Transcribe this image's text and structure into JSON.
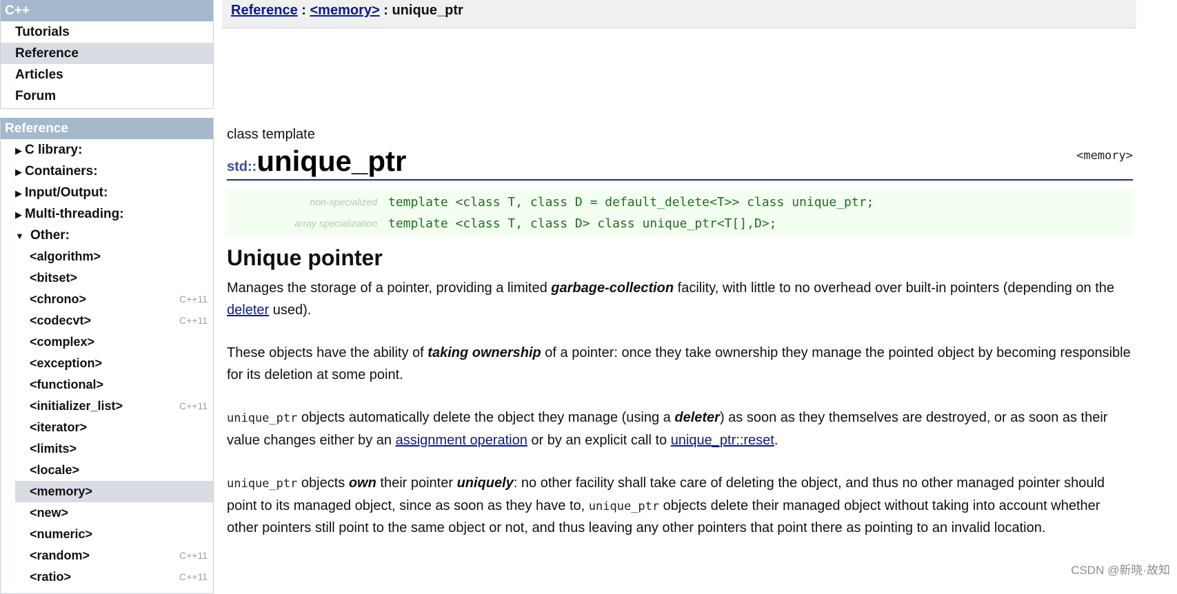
{
  "sidebar": {
    "nav_header": "C++",
    "nav_items": [
      {
        "label": "Tutorials",
        "active": false
      },
      {
        "label": "Reference",
        "active": true
      },
      {
        "label": "Articles",
        "active": false
      },
      {
        "label": "Forum",
        "active": false
      }
    ],
    "ref_header": "Reference",
    "categories": [
      {
        "label": "C library:",
        "expanded": false
      },
      {
        "label": "Containers:",
        "expanded": false
      },
      {
        "label": "Input/Output:",
        "expanded": false
      },
      {
        "label": "Multi-threading:",
        "expanded": false
      },
      {
        "label": "Other:",
        "expanded": true
      }
    ],
    "libraries": [
      {
        "label": "<algorithm>",
        "tag": ""
      },
      {
        "label": "<bitset>",
        "tag": ""
      },
      {
        "label": "<chrono>",
        "tag": "C++11"
      },
      {
        "label": "<codecvt>",
        "tag": "C++11"
      },
      {
        "label": "<complex>",
        "tag": ""
      },
      {
        "label": "<exception>",
        "tag": ""
      },
      {
        "label": "<functional>",
        "tag": ""
      },
      {
        "label": "<initializer_list>",
        "tag": "C++11"
      },
      {
        "label": "<iterator>",
        "tag": ""
      },
      {
        "label": "<limits>",
        "tag": ""
      },
      {
        "label": "<locale>",
        "tag": ""
      },
      {
        "label": "<memory>",
        "tag": "",
        "active": true
      },
      {
        "label": "<new>",
        "tag": ""
      },
      {
        "label": "<numeric>",
        "tag": ""
      },
      {
        "label": "<random>",
        "tag": "C++11"
      },
      {
        "label": "<ratio>",
        "tag": "C++11"
      }
    ]
  },
  "breadcrumb": {
    "root": "Reference",
    "sep1": " : ",
    "header": "<memory>",
    "sep2": " : ",
    "current": "unique_ptr"
  },
  "article": {
    "kind": "class template",
    "namespace": "std::",
    "name": "unique_ptr",
    "header_tag": "<memory>",
    "declarations": [
      {
        "label": "non-specialized",
        "code": "template <class T, class D = default_delete<T>> class unique_ptr;"
      },
      {
        "label": "array specialization",
        "code": "template <class T, class D> class unique_ptr<T[],D>;"
      }
    ],
    "section_title": "Unique pointer",
    "p1": {
      "a": "Manages the storage of a pointer, providing a limited ",
      "b": "garbage-collection",
      "c": " facility, with little to no overhead over built-in pointers (depending on the ",
      "link": "deleter",
      "d": " used)."
    },
    "p2": {
      "a": "These objects have the ability of ",
      "b": "taking ownership",
      "c": " of a pointer: once they take ownership they manage the pointed object by becoming responsible for its deletion at some point."
    },
    "p3": {
      "code": "unique_ptr",
      "a": " objects automatically delete the object they manage (using a ",
      "b": "deleter",
      "c": ") as soon as they themselves are destroyed, or as soon as their value changes either by an ",
      "link1": "assignment operation",
      "d": " or by an explicit call to ",
      "link2": "unique_ptr::reset",
      "e": "."
    },
    "p4": {
      "code": "unique_ptr",
      "a": " objects ",
      "b": "own",
      "c": " their pointer ",
      "d": "uniquely",
      "e": ": no other facility shall take care of deleting the object, and thus no other managed pointer should point to its managed object, since as soon as they have to, ",
      "code2": "unique_ptr",
      "f": " objects delete their managed object without taking into account whether other pointers still point to the same object or not, and thus leaving any other pointers that point there as pointing to an invalid location."
    }
  },
  "watermark": "CSDN @新晓·故知"
}
